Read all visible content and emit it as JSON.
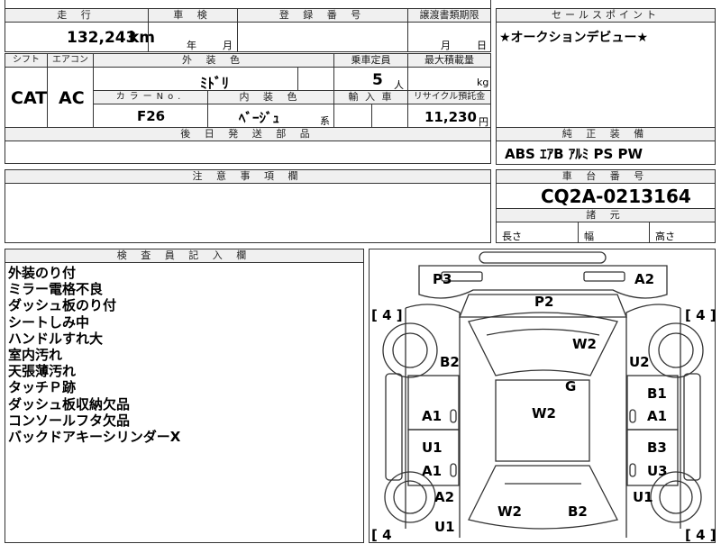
{
  "top_row": {
    "mileage_label": "走 行",
    "mileage_value": "132,243",
    "mileage_unit": "km",
    "inspection_label": "車 検",
    "inspection_year_unit": "年",
    "inspection_month_unit": "月",
    "registration_label": "登 録 番 号",
    "transfer_label": "譲渡書類期限",
    "transfer_month_unit": "月",
    "transfer_day_unit": "日",
    "sales_point_label": "セールスポイント",
    "sales_point_text": "★オークションデビュー★"
  },
  "second_row": {
    "shift_label": "シフト",
    "aircon_label": "エアコン",
    "exterior_label": "外 装 色",
    "capacity_label": "乗車定員",
    "max_load_label": "最大積載量",
    "shift_value": "CAT",
    "aircon_value": "AC",
    "exterior_value": "ﾐﾄﾞﾘ",
    "capacity_value": "5",
    "capacity_unit": "人",
    "max_load_unit": "kg",
    "color_no_label": "カラーNo.",
    "interior_label": "内 装 色",
    "import_label": "輸 入 車",
    "recycle_label": "リサイクル預託金",
    "color_no_value": "F26",
    "interior_value": "ﾍﾞｰｼﾞｭ",
    "interior_suffix": "系",
    "recycle_value": "11,230",
    "recycle_unit": "円",
    "later_parts_label": "後 日 発 送 部 品"
  },
  "equipment": {
    "label": "純 正 装 備",
    "value": "ABS ｴｱB ｱﾙﾐ PS PW"
  },
  "caution": {
    "label": "注 意 事 項 欄"
  },
  "chassis": {
    "label": "車 台 番 号",
    "value": "CQ2A-0213164",
    "dims_label": "諸 元",
    "length_label": "長さ",
    "width_label": "幅",
    "height_label": "高さ"
  },
  "inspector": {
    "label": "検 査 員 記 入 欄",
    "remarks": [
      "外装のり付",
      "ミラー電格不良",
      "ダッシュ板のり付",
      "シートしみ中",
      "ハンドルすれ大",
      "室内汚れ",
      "天張薄汚れ",
      "タッチＰ跡",
      "ダッシュ板収納欠品",
      "コンソールフタ欠品",
      "バックドアキーシリンダーX"
    ]
  },
  "diagram": {
    "tire_labels": [
      "[ 4 ]",
      "[ 4 ]",
      "[ 4",
      "[ 4 ]"
    ],
    "marks": {
      "p3": "P3",
      "a2_top": "A2",
      "p2": "P2",
      "w2_hood": "W2",
      "b2_left": "B2",
      "u2_right": "U2",
      "g": "G",
      "a1_left": "A1",
      "w2_center": "W2",
      "b1_right": "B1",
      "a1_right": "A1",
      "u1_left": "U1",
      "b3_right": "B3",
      "a1_left2": "A1",
      "u3_right": "U3",
      "a2_left": "A2",
      "u1_right": "U1",
      "w2_rear": "W2",
      "b2_rear": "B2",
      "u1_bottom": "U1"
    }
  }
}
